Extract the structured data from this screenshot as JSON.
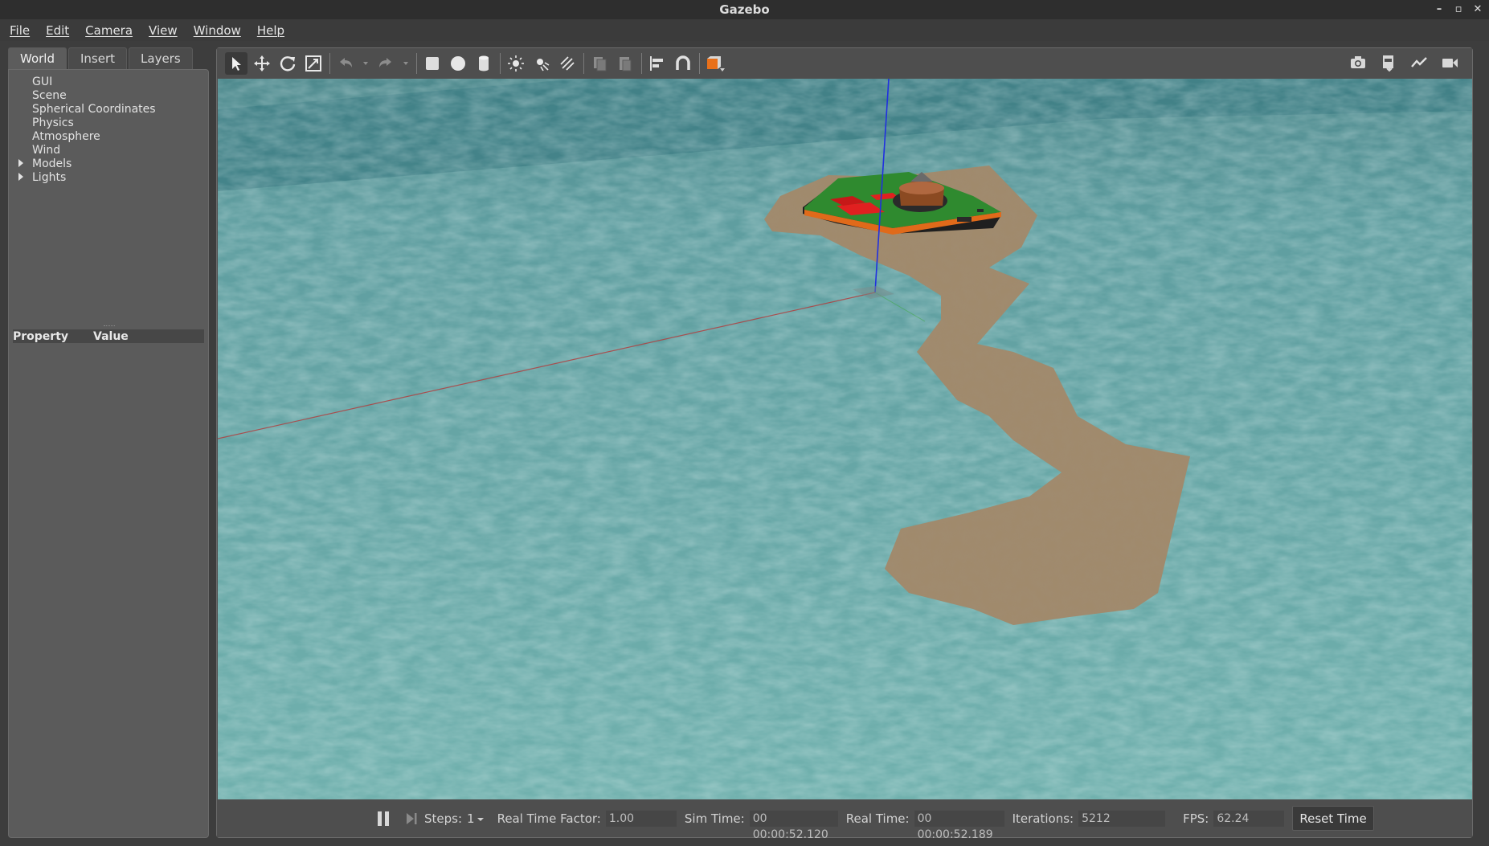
{
  "window": {
    "title": "Gazebo"
  },
  "menu": [
    "File",
    "Edit",
    "Camera",
    "View",
    "Window",
    "Help"
  ],
  "left_panel": {
    "tabs": [
      "World",
      "Insert",
      "Layers"
    ],
    "active_tab": "World",
    "tree": [
      {
        "label": "GUI",
        "expandable": false
      },
      {
        "label": "Scene",
        "expandable": false
      },
      {
        "label": "Spherical Coordinates",
        "expandable": false
      },
      {
        "label": "Physics",
        "expandable": false
      },
      {
        "label": "Atmosphere",
        "expandable": false
      },
      {
        "label": "Wind",
        "expandable": false
      },
      {
        "label": "Models",
        "expandable": true
      },
      {
        "label": "Lights",
        "expandable": true
      }
    ],
    "property_header": {
      "property": "Property",
      "value": "Value"
    }
  },
  "toolbar": {
    "tools": [
      "select-arrow-icon",
      "translate-icon",
      "rotate-icon",
      "scale-icon",
      "undo-icon",
      "redo-icon",
      "box-icon",
      "sphere-icon",
      "cylinder-icon",
      "point-light-icon",
      "spot-light-icon",
      "directional-light-icon",
      "copy-icon",
      "paste-icon",
      "align-icon",
      "snap-icon",
      "view-angle-icon"
    ],
    "right_tools": [
      "screenshot-icon",
      "log-icon",
      "plot-icon",
      "video-record-icon"
    ]
  },
  "bottom_bar": {
    "steps_label": "Steps:",
    "steps_value": "1",
    "rtf_label": "Real Time Factor:",
    "rtf_value": "1.00",
    "sim_time_label": "Sim Time:",
    "sim_time_value": "00 00:00:52.120",
    "real_time_label": "Real Time:",
    "real_time_value": "00 00:00:52.189",
    "iterations_label": "Iterations:",
    "iterations_value": "5212",
    "fps_label": "FPS:",
    "fps_value": "62.24",
    "reset_label": "Reset Time"
  },
  "colors": {
    "water": "#6aa6a6",
    "sand": "#9a846a",
    "platform_green": "#2f8a2f",
    "platform_edge": "#e06a1a",
    "red_objects": "#e02020",
    "x_axis": "#b04040",
    "z_axis": "#2030e0"
  }
}
